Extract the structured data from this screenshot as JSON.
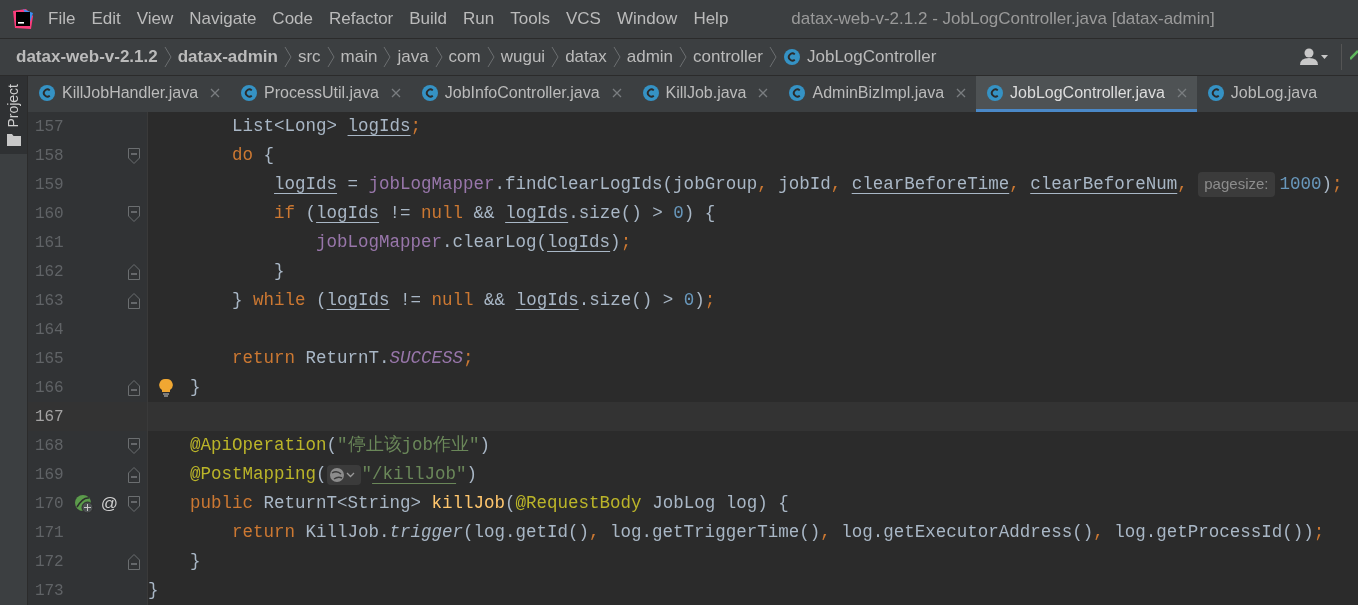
{
  "menu_bar": {
    "items": [
      "File",
      "Edit",
      "View",
      "Navigate",
      "Code",
      "Refactor",
      "Build",
      "Run",
      "Tools",
      "VCS",
      "Window",
      "Help"
    ],
    "title": "datax-web-v-2.1.2 - JobLogController.java [datax-admin]"
  },
  "breadcrumb": [
    {
      "label": "datax-web-v-2.1.2",
      "bold": true,
      "kind": "text"
    },
    {
      "label": "datax-admin",
      "bold": true,
      "kind": "text"
    },
    {
      "label": "src",
      "bold": false,
      "kind": "text"
    },
    {
      "label": "main",
      "bold": false,
      "kind": "text"
    },
    {
      "label": "java",
      "bold": false,
      "kind": "text"
    },
    {
      "label": "com",
      "bold": false,
      "kind": "text"
    },
    {
      "label": "wugui",
      "bold": false,
      "kind": "text"
    },
    {
      "label": "datax",
      "bold": false,
      "kind": "text"
    },
    {
      "label": "admin",
      "bold": false,
      "kind": "text"
    },
    {
      "label": "controller",
      "bold": false,
      "kind": "text"
    },
    {
      "label": "JobLogController",
      "bold": false,
      "kind": "class"
    }
  ],
  "side_strip": {
    "label": "Project"
  },
  "tabs": [
    {
      "label": "KillJobHandler.java",
      "selected": false,
      "closable": true
    },
    {
      "label": "ProcessUtil.java",
      "selected": false,
      "closable": true
    },
    {
      "label": "JobInfoController.java",
      "selected": false,
      "closable": true
    },
    {
      "label": "KillJob.java",
      "selected": false,
      "closable": true
    },
    {
      "label": "AdminBizImpl.java",
      "selected": false,
      "closable": true
    },
    {
      "label": "JobLogController.java",
      "selected": true,
      "closable": true
    },
    {
      "label": "JobLog.java",
      "selected": false,
      "closable": false
    }
  ],
  "editor": {
    "lines": [
      {
        "number": "157",
        "current": false,
        "tokens": [
          {
            "kind": "plain",
            "text": "        List<Long> "
          },
          {
            "kind": "ul",
            "text": "logIds"
          },
          {
            "kind": "kw",
            "text": ";"
          }
        ]
      },
      {
        "number": "158",
        "current": false,
        "fold_start": true,
        "tokens": [
          {
            "kind": "kw",
            "text": "        do "
          },
          {
            "kind": "plain",
            "text": "{"
          }
        ]
      },
      {
        "number": "159",
        "current": false,
        "tokens": [
          {
            "kind": "ul",
            "text": "            logIds"
          },
          {
            "kind": "plain",
            "text": " = "
          },
          {
            "kind": "field",
            "text": "jobLogMapper"
          },
          {
            "kind": "plain",
            "text": ".findClearLogIds(jobGroup"
          },
          {
            "kind": "kw",
            "text": ", "
          },
          {
            "kind": "plain",
            "text": "jobId"
          },
          {
            "kind": "kw",
            "text": ", "
          },
          {
            "kind": "ul",
            "text": "clearBeforeTime"
          },
          {
            "kind": "kw",
            "text": ", "
          },
          {
            "kind": "ul",
            "text": "clearBeforeNum"
          },
          {
            "kind": "kw",
            "text": ", "
          },
          {
            "kind": "hint",
            "text": "pagesize:"
          },
          {
            "kind": "num",
            "text": "1000"
          },
          {
            "kind": "plain",
            "text": ")"
          },
          {
            "kind": "kw",
            "text": ";"
          }
        ]
      },
      {
        "number": "160",
        "current": false,
        "fold_start": true,
        "tokens": [
          {
            "kind": "kw",
            "text": "            if "
          },
          {
            "kind": "plain",
            "text": "("
          },
          {
            "kind": "ul",
            "text": "logIds"
          },
          {
            "kind": "plain",
            "text": " != "
          },
          {
            "kind": "kw",
            "text": "null "
          },
          {
            "kind": "plain",
            "text": "&& "
          },
          {
            "kind": "ul",
            "text": "logIds"
          },
          {
            "kind": "plain",
            "text": ".size() > "
          },
          {
            "kind": "num",
            "text": "0"
          },
          {
            "kind": "plain",
            "text": ") {"
          }
        ]
      },
      {
        "number": "161",
        "current": false,
        "tokens": [
          {
            "kind": "field",
            "text": "                jobLogMapper"
          },
          {
            "kind": "plain",
            "text": ".clearLog("
          },
          {
            "kind": "ul",
            "text": "logIds"
          },
          {
            "kind": "plain",
            "text": ")"
          },
          {
            "kind": "kw",
            "text": ";"
          }
        ]
      },
      {
        "number": "162",
        "current": false,
        "fold_end": true,
        "tokens": [
          {
            "kind": "plain",
            "text": "            }"
          }
        ]
      },
      {
        "number": "163",
        "current": false,
        "fold_end": true,
        "tokens": [
          {
            "kind": "plain",
            "text": "        } "
          },
          {
            "kind": "kw",
            "text": "while "
          },
          {
            "kind": "plain",
            "text": "("
          },
          {
            "kind": "ul",
            "text": "logIds"
          },
          {
            "kind": "plain",
            "text": " != "
          },
          {
            "kind": "kw",
            "text": "null "
          },
          {
            "kind": "plain",
            "text": "&& "
          },
          {
            "kind": "ul",
            "text": "logIds"
          },
          {
            "kind": "plain",
            "text": ".size() > "
          },
          {
            "kind": "num",
            "text": "0"
          },
          {
            "kind": "plain",
            "text": ")"
          },
          {
            "kind": "kw",
            "text": ";"
          }
        ]
      },
      {
        "number": "164",
        "current": false
      },
      {
        "number": "165",
        "current": false,
        "tokens": [
          {
            "kind": "kw",
            "text": "        return "
          },
          {
            "kind": "plain",
            "text": "ReturnT."
          },
          {
            "kind": "static",
            "text": "SUCCESS"
          },
          {
            "kind": "kw",
            "text": ";"
          }
        ]
      },
      {
        "number": "166",
        "current": false,
        "fold_end": true,
        "bulb": true,
        "tokens": [
          {
            "kind": "plain",
            "text": "    }"
          }
        ]
      },
      {
        "number": "167",
        "current": true
      },
      {
        "number": "168",
        "current": false,
        "fold_start": true,
        "tokens": [
          {
            "kind": "anno",
            "text": "    @ApiOperation"
          },
          {
            "kind": "plain",
            "text": "("
          },
          {
            "kind": "str",
            "text": "\"停止该job作业\""
          },
          {
            "kind": "plain",
            "text": ")"
          }
        ]
      },
      {
        "number": "169",
        "current": false,
        "fold_end": true,
        "tokens": [
          {
            "kind": "anno",
            "text": "    @PostMapping"
          },
          {
            "kind": "plain",
            "text": "("
          },
          {
            "kind": "icon"
          },
          {
            "kind": "str",
            "text": "\""
          },
          {
            "kind": "ulstr",
            "text": "/killJob"
          },
          {
            "kind": "str",
            "text": "\""
          },
          {
            "kind": "plain",
            "text": ")"
          }
        ]
      },
      {
        "number": "170",
        "current": false,
        "fold_start": true,
        "bean_marker": true,
        "gutter_text": "@",
        "tokens": [
          {
            "kind": "kw",
            "text": "    public "
          },
          {
            "kind": "plain",
            "text": "ReturnT<String> "
          },
          {
            "kind": "decl",
            "text": "killJob"
          },
          {
            "kind": "plain",
            "text": "("
          },
          {
            "kind": "anno",
            "text": "@RequestBody "
          },
          {
            "kind": "plain",
            "text": "JobLog log) {"
          }
        ]
      },
      {
        "number": "171",
        "current": false,
        "tokens": [
          {
            "kind": "kw",
            "text": "        return "
          },
          {
            "kind": "plain",
            "text": "KillJob."
          },
          {
            "kind": "italic",
            "text": "trigger"
          },
          {
            "kind": "plain",
            "text": "(log.getId()"
          },
          {
            "kind": "kw",
            "text": ", "
          },
          {
            "kind": "plain",
            "text": "log.getTriggerTime()"
          },
          {
            "kind": "kw",
            "text": ", "
          },
          {
            "kind": "plain",
            "text": "log.getExecutorAddress()"
          },
          {
            "kind": "kw",
            "text": ", "
          },
          {
            "kind": "plain",
            "text": "log.getProcessId())"
          },
          {
            "kind": "kw",
            "text": ";"
          }
        ]
      },
      {
        "number": "172",
        "current": false,
        "fold_end": true,
        "tokens": [
          {
            "kind": "plain",
            "text": "    }"
          }
        ]
      },
      {
        "number": "173",
        "current": false,
        "tokens": [
          {
            "kind": "plain",
            "text": "}"
          }
        ]
      }
    ]
  }
}
